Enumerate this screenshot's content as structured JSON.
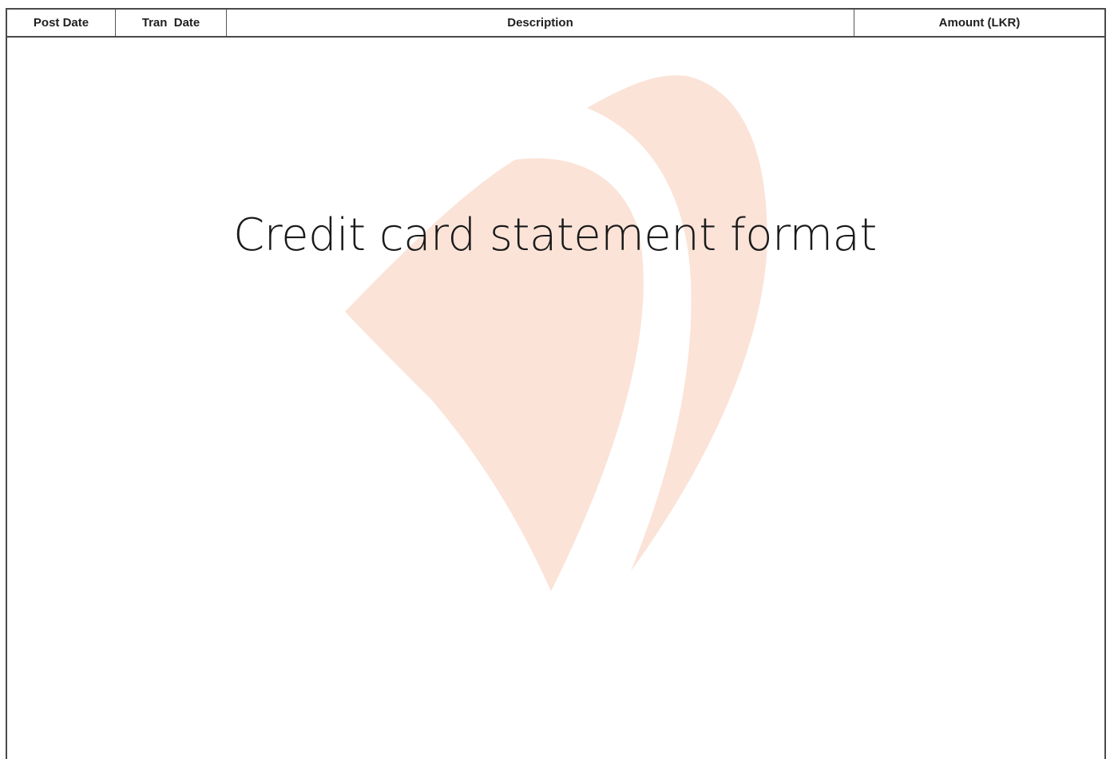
{
  "table": {
    "headers": {
      "post_date": "Post Date",
      "tran_date": "Tran  Date",
      "description": "Description",
      "amount": "Amount (LKR)"
    }
  },
  "title": "Credit card statement format",
  "watermark": {
    "icon": "sail-logo-watermark-icon",
    "color": "#fbe3d8"
  }
}
